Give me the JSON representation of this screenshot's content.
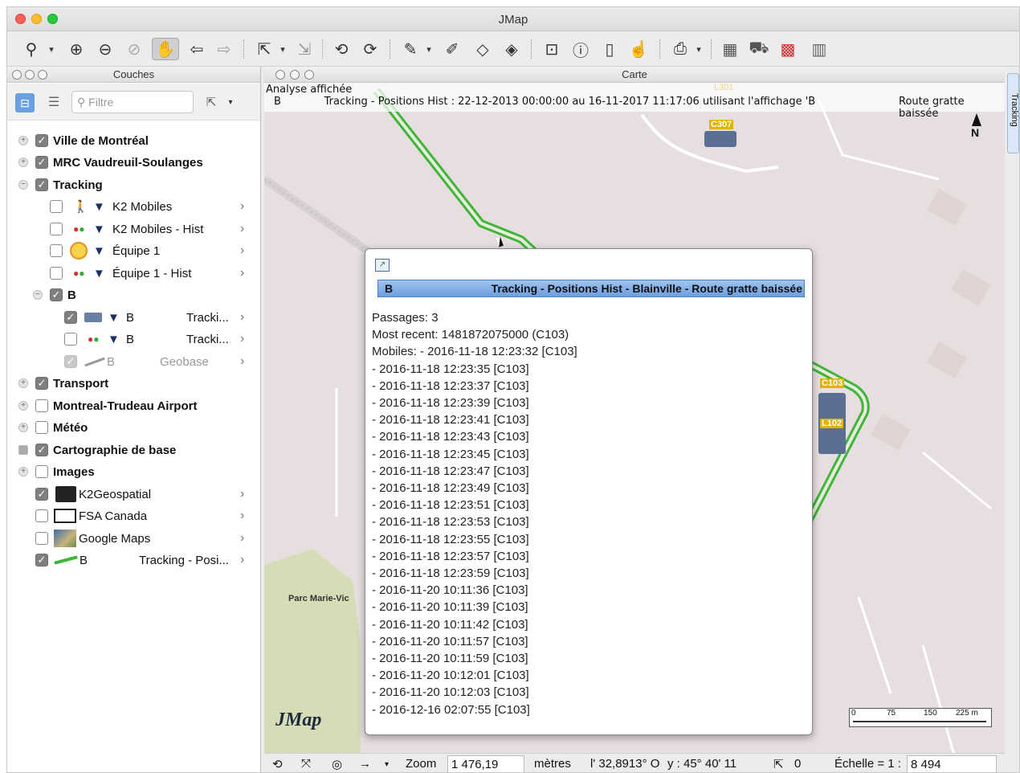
{
  "window": {
    "title": "JMap"
  },
  "layers_panel": {
    "title": "Couches",
    "filter_placeholder": "Filtre",
    "layers": [
      {
        "label": "Ville de Montréal",
        "checked": true,
        "bold": true
      },
      {
        "label": "MRC Vaudreuil-Soulanges",
        "checked": true,
        "bold": true
      },
      {
        "label": "Tracking",
        "checked": true,
        "bold": true
      },
      {
        "label": "K2 Mobiles",
        "checked": false
      },
      {
        "label": "K2 Mobiles - Hist",
        "checked": false
      },
      {
        "label": "Équipe 1",
        "checked": false
      },
      {
        "label": "Équipe 1 - Hist",
        "checked": false
      },
      {
        "label": "B",
        "checked": true,
        "bold": true
      },
      {
        "label": "B",
        "secondary": "Tracki...",
        "checked": true
      },
      {
        "label": "B",
        "secondary": "Tracki...",
        "checked": false
      },
      {
        "label": "B",
        "secondary": "Geobase",
        "checked": true,
        "disabled": true
      },
      {
        "label": "Transport",
        "checked": true,
        "bold": true
      },
      {
        "label": "Montreal-Trudeau Airport",
        "checked": false,
        "bold": true
      },
      {
        "label": "Météo",
        "checked": false,
        "bold": true
      },
      {
        "label": "Cartographie de base",
        "checked": true,
        "bold": true
      },
      {
        "label": "Images",
        "checked": false,
        "bold": true
      },
      {
        "label": "K2Geospatial",
        "checked": true
      },
      {
        "label": "FSA Canada",
        "checked": false
      },
      {
        "label": "Google Maps",
        "checked": false
      },
      {
        "label": "B",
        "secondary": "Tracking - Posi...",
        "checked": true
      }
    ]
  },
  "map_panel": {
    "title": "Carte",
    "analysis_label": "Analyse affichée",
    "analysis_line": "B             Tracking - Positions Hist : 22-12-2013 00:00:00 au 16-11-2017 11:17:06 utilisant l'affichage 'B",
    "analysis_right": "Route gratte baissée",
    "north_label": "N",
    "park_label": "Parc Marie-Vic",
    "logo": "JMap",
    "vehicle_labels": [
      "C307",
      "C103",
      "L102",
      "L301"
    ],
    "scale_bar": [
      "0",
      "75",
      "150",
      "225 m"
    ],
    "right_tab": "Tracking"
  },
  "popup": {
    "header_left": "B",
    "header_title": "Tracking - Positions Hist - Blainville - Route gratte baissée",
    "lines": [
      "Passages: 3",
      "Most recent: 1481872075000 (C103)",
      "Mobiles: - 2016-11-18 12:23:32 [C103]",
      "- 2016-11-18 12:23:35 [C103]",
      "- 2016-11-18 12:23:37 [C103]",
      "- 2016-11-18 12:23:39 [C103]",
      "- 2016-11-18 12:23:41 [C103]",
      "- 2016-11-18 12:23:43 [C103]",
      "- 2016-11-18 12:23:45 [C103]",
      "- 2016-11-18 12:23:47 [C103]",
      "- 2016-11-18 12:23:49 [C103]",
      "- 2016-11-18 12:23:51 [C103]",
      "- 2016-11-18 12:23:53 [C103]",
      "- 2016-11-18 12:23:55 [C103]",
      "- 2016-11-18 12:23:57 [C103]",
      "- 2016-11-18 12:23:59 [C103]",
      "- 2016-11-20 10:11:36 [C103]",
      "- 2016-11-20 10:11:39 [C103]",
      "- 2016-11-20 10:11:42 [C103]",
      "- 2016-11-20 10:11:57 [C103]",
      "- 2016-11-20 10:11:59 [C103]",
      "- 2016-11-20 10:12:01 [C103]",
      "- 2016-11-20 10:12:03 [C103]",
      "- 2016-12-16 02:07:55 [C103]"
    ]
  },
  "statusbar": {
    "zoom_label": "Zoom",
    "zoom_value": "1 476,19",
    "units": "mètres",
    "coord_x": "l' 32,8913° O",
    "coord_y": "y : 45° 40' 11",
    "count": "0",
    "scale_label": "Échelle = 1 :",
    "scale_value": "8 494"
  },
  "colors": {
    "route": "#3fb53a",
    "popup_header": "#8db8ea",
    "map_bg": "#e6dede",
    "park": "#d5dcb6"
  }
}
